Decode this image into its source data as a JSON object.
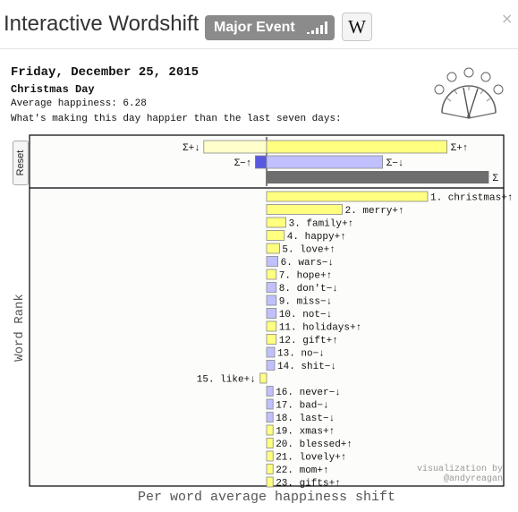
{
  "header": {
    "title": "Interactive Wordshift",
    "badge_label": "Major Event",
    "wiki_glyph": "W",
    "close_glyph": "×"
  },
  "info": {
    "date": "Friday, December 25, 2015",
    "event": "Christmas Day",
    "happiness": "Average happiness: 6.28",
    "question": "What's making this day happier than the last seven days:"
  },
  "controls": {
    "reset_label": "Reset"
  },
  "chart_data": {
    "type": "bar",
    "orientation": "horizontal",
    "ylabel": "Word Rank",
    "xlabel": "Per word average happiness shift",
    "credit_line1": "visualization by",
    "credit_line2": "@andyreagan",
    "colors": {
      "positive_up": "#ffff80",
      "negative_down": "#c0c0ff",
      "summary_pos_down": "#ffffcc",
      "summary_neg_up": "#5858e0",
      "summary_total": "#6e6e6e",
      "bar_edge": "#888888"
    },
    "summary": [
      {
        "bar": "pos_down",
        "label": "Σ+↓",
        "value": -0.39
      },
      {
        "bar": "pos_up",
        "label": "Σ+↑",
        "value": 1.12
      },
      {
        "bar": "neg_up",
        "label": "Σ−↑",
        "value": -0.07
      },
      {
        "bar": "neg_down",
        "label": "Σ−↓",
        "value": 0.72
      },
      {
        "bar": "total",
        "label": "Σ",
        "value": 1.38
      }
    ],
    "words": [
      {
        "rank": 1,
        "word": "christmas",
        "sign": "+",
        "dir": "↑",
        "value": 1.0
      },
      {
        "rank": 2,
        "word": "merry",
        "sign": "+",
        "dir": "↑",
        "value": 0.47
      },
      {
        "rank": 3,
        "word": "family",
        "sign": "+",
        "dir": "↑",
        "value": 0.12
      },
      {
        "rank": 4,
        "word": "happy",
        "sign": "+",
        "dir": "↑",
        "value": 0.11
      },
      {
        "rank": 5,
        "word": "love",
        "sign": "+",
        "dir": "↑",
        "value": 0.08
      },
      {
        "rank": 6,
        "word": "wars",
        "sign": "−",
        "dir": "↓",
        "value": 0.07
      },
      {
        "rank": 7,
        "word": "hope",
        "sign": "+",
        "dir": "↑",
        "value": 0.06
      },
      {
        "rank": 8,
        "word": "don't",
        "sign": "−",
        "dir": "↓",
        "value": 0.06
      },
      {
        "rank": 9,
        "word": "miss",
        "sign": "−",
        "dir": "↓",
        "value": 0.06
      },
      {
        "rank": 10,
        "word": "not",
        "sign": "−",
        "dir": "↓",
        "value": 0.06
      },
      {
        "rank": 11,
        "word": "holidays",
        "sign": "+",
        "dir": "↑",
        "value": 0.06
      },
      {
        "rank": 12,
        "word": "gift",
        "sign": "+",
        "dir": "↑",
        "value": 0.06
      },
      {
        "rank": 13,
        "word": "no",
        "sign": "−",
        "dir": "↓",
        "value": 0.05
      },
      {
        "rank": 14,
        "word": "shit",
        "sign": "−",
        "dir": "↓",
        "value": 0.05
      },
      {
        "rank": 15,
        "word": "like",
        "sign": "+",
        "dir": "↓",
        "value": -0.04
      },
      {
        "rank": 16,
        "word": "never",
        "sign": "−",
        "dir": "↓",
        "value": 0.04
      },
      {
        "rank": 17,
        "word": "bad",
        "sign": "−",
        "dir": "↓",
        "value": 0.04
      },
      {
        "rank": 18,
        "word": "last",
        "sign": "−",
        "dir": "↓",
        "value": 0.04
      },
      {
        "rank": 19,
        "word": "xmas",
        "sign": "+",
        "dir": "↑",
        "value": 0.04
      },
      {
        "rank": 20,
        "word": "blessed",
        "sign": "+",
        "dir": "↑",
        "value": 0.04
      },
      {
        "rank": 21,
        "word": "lovely",
        "sign": "+",
        "dir": "↑",
        "value": 0.04
      },
      {
        "rank": 22,
        "word": "mom",
        "sign": "+",
        "dir": "↑",
        "value": 0.04
      },
      {
        "rank": 23,
        "word": "gifts",
        "sign": "+",
        "dir": "↑",
        "value": 0.04
      }
    ]
  }
}
